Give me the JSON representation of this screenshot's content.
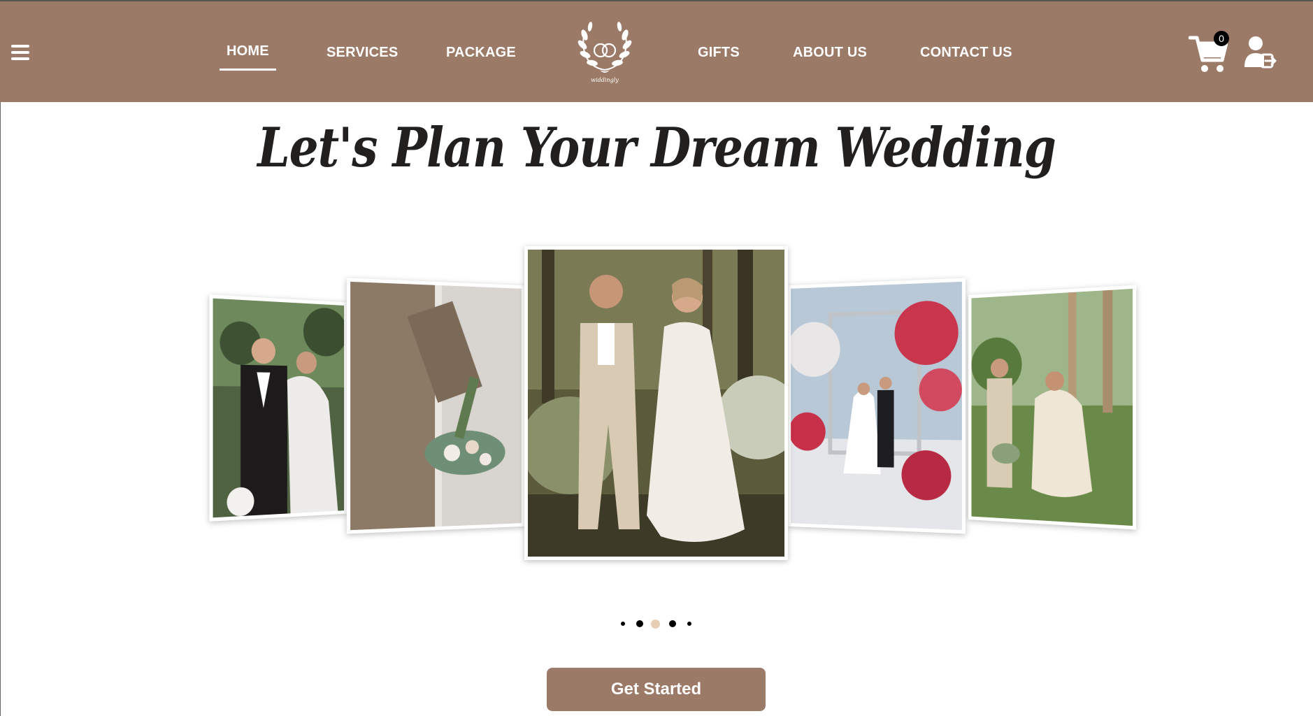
{
  "header": {
    "nav_left": [
      {
        "label": "HOME",
        "active": true
      },
      {
        "label": "SERVICES",
        "active": false
      },
      {
        "label": "PACKAGE",
        "active": false
      }
    ],
    "nav_right": [
      {
        "label": "GIFTS",
        "active": false
      },
      {
        "label": "ABOUT US",
        "active": false
      },
      {
        "label": "CONTACT US",
        "active": false
      }
    ],
    "logo_text": "widdingly",
    "cart_count": "0"
  },
  "hero": {
    "headline": "Let's Plan Your Dream Wedding",
    "cta_label": "Get Started"
  },
  "carousel": {
    "active_index": 2,
    "slide_count": 5
  },
  "colors": {
    "brand": "#9c7a68",
    "active_dot": "#e8cdb5"
  },
  "icons": [
    "hamburger-menu-icon",
    "cart-icon",
    "user-logout-icon",
    "laurel-rings-logo"
  ]
}
